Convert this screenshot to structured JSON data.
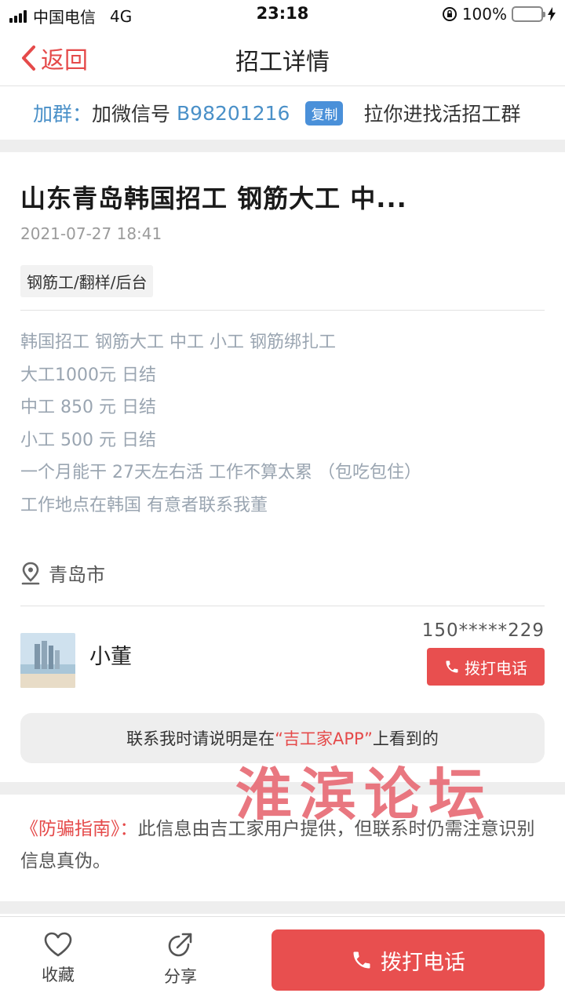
{
  "status_bar": {
    "carrier": "中国电信",
    "network": "4G",
    "time": "23:18",
    "battery": "100%",
    "battery_level": 1.0
  },
  "nav": {
    "back_label": "返回",
    "title": "招工详情"
  },
  "group_banner": {
    "label": "加群：",
    "text": "加微信号",
    "wechat_id": "B98201216",
    "copy_label": "复制",
    "suffix": "拉你进找活招工群"
  },
  "job": {
    "title": "山东青岛韩国招工  钢筋大工 中...",
    "date": "2021-07-27 18:41",
    "tag": "钢筋工/翻样/后台",
    "description": [
      "韩国招工  钢筋大工 中工 小工  钢筋绑扎工",
      "大工1000元 日结",
      "中工 850  元 日结",
      "小工 500  元 日结",
      "一个月能干 27天左右活   工作不算太累  （包吃包住）",
      "工作地点在韩国  有意者联系我董"
    ],
    "location": "青岛市"
  },
  "contact": {
    "name": "小董",
    "phone": "150*****229",
    "call_label": "拨打电话"
  },
  "notice": {
    "prefix": "联系我时请说明是在",
    "highlight": "“吉工家APP”",
    "suffix": "上看到的"
  },
  "anti_fraud": {
    "title": "《防骗指南》：",
    "text": "此信息由吉工家用户提供，但联系时仍需注意识别信息真伪。"
  },
  "watermark": "淮滨论坛",
  "bottom_bar": {
    "favorite_label": "收藏",
    "share_label": "分享",
    "call_label": "拨打电话"
  },
  "colors": {
    "accent_red": "#e84f4f",
    "link_blue": "#4a90c8",
    "battery_green": "#3cc34a"
  }
}
